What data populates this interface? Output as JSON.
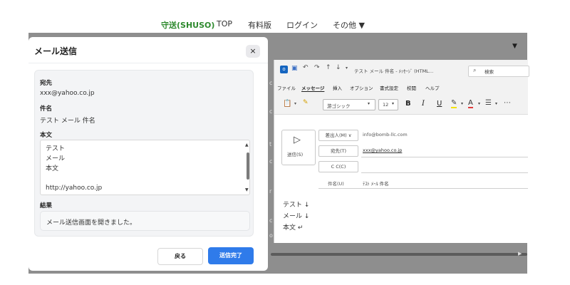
{
  "nav": {
    "brand": "守送(SHUSO)",
    "items": [
      "TOP",
      "有料版",
      "ログイン",
      "その他 ▼"
    ]
  },
  "backdrop": {
    "arrow": "▼",
    "scroll_arrow": "▶",
    "edge_chars": [
      "c",
      "c",
      "t",
      "c",
      "r",
      "c",
      "o"
    ]
  },
  "dialog": {
    "title": "メール送信",
    "close": "×",
    "to_label": "宛先",
    "to_value": "xxx@yahoo.co.jp",
    "subject_label": "件名",
    "subject_value": "テスト メール 件名",
    "body_label": "本文",
    "body_lines": [
      "テスト",
      "メール",
      "本文",
      "",
      "http://yahoo.co.jp"
    ],
    "scroll_up": "▲",
    "scroll_down": "▼",
    "result_label": "結果",
    "result_text": "メール送信画面を開きました。",
    "back_button": "戻る",
    "done_button": "送信完了"
  },
  "outlook": {
    "title": "テスト メール 件名 - ﾒｯｾｰｼﾞ (HTML…",
    "search_placeholder": "検索",
    "menu": [
      "ファイル",
      "メッセージ",
      "挿入",
      "オプション",
      "書式設定",
      "校閲",
      "ヘルプ"
    ],
    "active_menu": "メッセージ",
    "font_name": "游ゴシック",
    "font_size": "12",
    "toolbar_glyphs": [
      "B",
      "I",
      "U"
    ],
    "send_label": "送信(S)",
    "from_button": "差出人(M) ∨",
    "from_value": "info@bomb-llc.com",
    "to_button": "宛先(T)",
    "to_value": "xxx@yahoo.co.jp",
    "cc_button": "C C(C)",
    "subject_label": "件名(U)",
    "subject_value": "ﾃｽﾄ ﾒｰﾙ 件名",
    "body_lines": [
      "テスト ↓",
      "メール ↓",
      "本文 ↵"
    ]
  },
  "colors": {
    "brand_green": "#2e8a2e",
    "primary_button": "#2f7bea",
    "backdrop": "#8e8e8e"
  }
}
